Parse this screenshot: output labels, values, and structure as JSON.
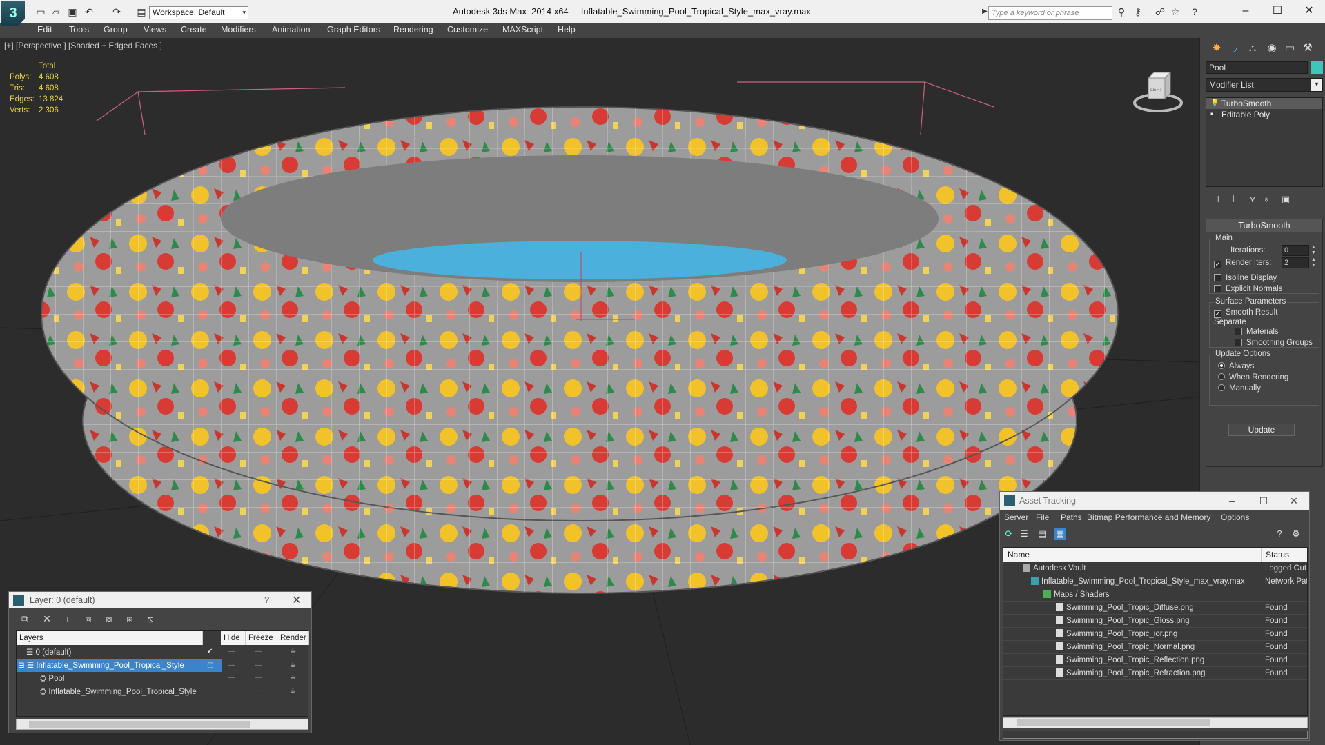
{
  "title_bar": {
    "logo_letter": "3",
    "workspace": "Workspace: Default",
    "title": "Autodesk 3ds Max  2014 x64     Inflatable_Swimming_Pool_Tropical_Style_max_vray.max",
    "search_placeholder": "Type a keyword or phrase"
  },
  "menu": [
    "Edit",
    "Tools",
    "Group",
    "Views",
    "Create",
    "Modifiers",
    "Animation",
    "Graph Editors",
    "Rendering",
    "Customize",
    "MAXScript",
    "Help"
  ],
  "viewport": {
    "label": "[+] [Perspective ] [Shaded + Edged Faces ]",
    "viewcube_label": "LEFT",
    "stats": {
      "header": "Total",
      "rows": [
        {
          "label": "Polys:",
          "value": "4 608"
        },
        {
          "label": "Tris:",
          "value": "4 608"
        },
        {
          "label": "Edges:",
          "value": "13 824"
        },
        {
          "label": "Verts:",
          "value": "2 306"
        }
      ]
    }
  },
  "command_panel": {
    "object_name": "Pool",
    "object_color": "#3cc7b9",
    "modifier_list": "Modifier List",
    "stack": [
      "TurboSmooth",
      "Editable Poly"
    ],
    "rollout_title": "TurboSmooth",
    "main_group": "Main",
    "iterations_label": "Iterations:",
    "iterations_value": "0",
    "render_iters_label": "Render Iters:",
    "render_iters_value": "2",
    "isoline_display": "Isoline Display",
    "explicit_normals": "Explicit Normals",
    "surface_group": "Surface Parameters",
    "smooth_result": "Smooth Result",
    "separate_label": "Separate",
    "materials": "Materials",
    "smoothing_groups": "Smoothing Groups",
    "update_group": "Update Options",
    "always": "Always",
    "when_rendering": "When Rendering",
    "manually": "Manually",
    "update_button": "Update"
  },
  "layer_window": {
    "title": "Layer: 0 (default)",
    "help": "?",
    "columns": [
      "Layers",
      "Hide",
      "Freeze",
      "Render"
    ],
    "rows": [
      {
        "name": "0 (default)"
      },
      {
        "name": "Inflatable_Swimming_Pool_Tropical_Style"
      },
      {
        "name": "Pool"
      },
      {
        "name": "Inflatable_Swimming_Pool_Tropical_Style"
      }
    ]
  },
  "asset_window": {
    "title": "Asset Tracking",
    "menu": [
      "Server",
      "File",
      "Paths",
      "Bitmap Performance and Memory",
      "Options"
    ],
    "columns": [
      "Name",
      "Status"
    ],
    "rows": [
      {
        "name": "Autodesk Vault",
        "status": "Logged Out"
      },
      {
        "name": "Inflatable_Swimming_Pool_Tropical_Style_max_vray.max",
        "status": "Network Pat"
      },
      {
        "name": "Maps / Shaders",
        "status": ""
      },
      {
        "name": "Swimming_Pool_Tropic_Diffuse.png",
        "status": "Found"
      },
      {
        "name": "Swimming_Pool_Tropic_Gloss.png",
        "status": "Found"
      },
      {
        "name": "Swimming_Pool_Tropic_ior.png",
        "status": "Found"
      },
      {
        "name": "Swimming_Pool_Tropic_Normal.png",
        "status": "Found"
      },
      {
        "name": "Swimming_Pool_Tropic_Reflection.png",
        "status": "Found"
      },
      {
        "name": "Swimming_Pool_Tropic_Refraction.png",
        "status": "Found"
      }
    ]
  }
}
